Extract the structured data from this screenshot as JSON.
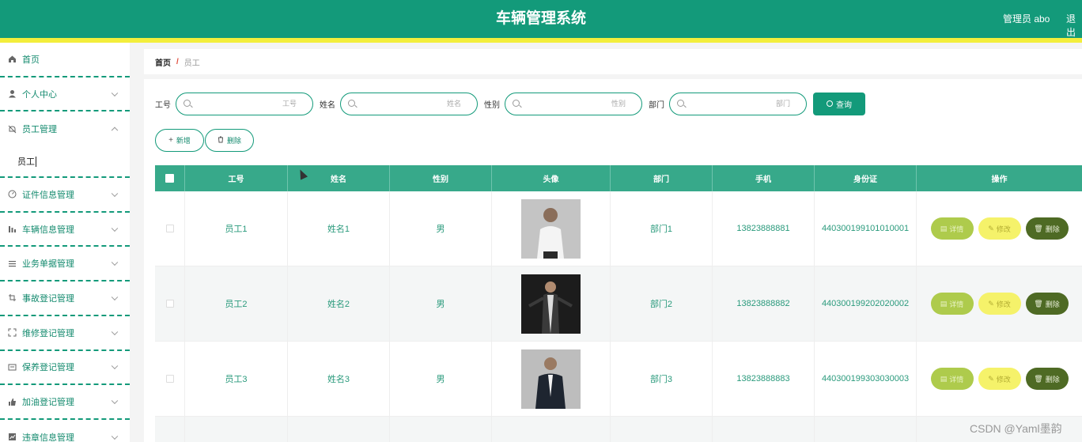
{
  "header": {
    "title": "车辆管理系统",
    "admin": "管理员 abo",
    "logout": "退出"
  },
  "sidebar": {
    "items": [
      {
        "label": "首页",
        "icon": "home-icon"
      },
      {
        "label": "个人中心",
        "icon": "user-icon"
      },
      {
        "label": "员工管理",
        "icon": "bell-off-icon"
      },
      {
        "label": "证件信息管理",
        "icon": "dashboard-icon"
      },
      {
        "label": "车辆信息管理",
        "icon": "bar-chart-icon"
      },
      {
        "label": "业务单据管理",
        "icon": "list-icon"
      },
      {
        "label": "事故登记管理",
        "icon": "crop-icon"
      },
      {
        "label": "维修登记管理",
        "icon": "full-screen-icon"
      },
      {
        "label": "保养登记管理",
        "icon": "tickets-icon"
      },
      {
        "label": "加油登记管理",
        "icon": "thumb-icon"
      },
      {
        "label": "违章信息管理",
        "icon": "chart-icon"
      }
    ],
    "submenu": {
      "label": "员工"
    }
  },
  "breadcrumb": {
    "home": "首页",
    "separator": "/",
    "current": "员工"
  },
  "search": {
    "fields": [
      {
        "label": "工号",
        "placeholder": "工号"
      },
      {
        "label": "姓名",
        "placeholder": "姓名"
      },
      {
        "label": "性别",
        "placeholder": "性别"
      },
      {
        "label": "部门",
        "placeholder": "部门"
      }
    ],
    "button": "查询"
  },
  "actions": {
    "add": "新增",
    "delete": "删除"
  },
  "table": {
    "columns": [
      "工号",
      "姓名",
      "性别",
      "头像",
      "部门",
      "手机",
      "身份证",
      "操作"
    ],
    "rows": [
      {
        "id": "员工1",
        "name": "姓名1",
        "gender": "男",
        "dept": "部门1",
        "phone": "13823888881",
        "idcard": "440300199101010001"
      },
      {
        "id": "员工2",
        "name": "姓名2",
        "gender": "男",
        "dept": "部门2",
        "phone": "13823888882",
        "idcard": "440300199202020002"
      },
      {
        "id": "员工3",
        "name": "姓名3",
        "gender": "男",
        "dept": "部门3",
        "phone": "13823888883",
        "idcard": "440300199303030003"
      }
    ],
    "ops": {
      "detail": "详情",
      "edit": "修改",
      "delete": "删除"
    }
  },
  "watermark": "CSDN @Yaml墨韵",
  "colors": {
    "primary": "#139a7a",
    "accent_stripe": "#f3ee3c",
    "table_header": "#37a98a"
  }
}
